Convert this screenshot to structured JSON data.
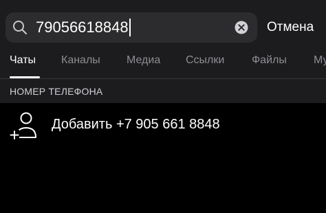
{
  "search": {
    "value": "79056618848",
    "cancel_label": "Отмена"
  },
  "tabs": [
    {
      "label": "Чаты",
      "active": true
    },
    {
      "label": "Каналы",
      "active": false
    },
    {
      "label": "Медиа",
      "active": false
    },
    {
      "label": "Ссылки",
      "active": false
    },
    {
      "label": "Файлы",
      "active": false
    },
    {
      "label": "Му",
      "active": false
    }
  ],
  "section": {
    "title": "НОМЕР ТЕЛЕФОНА"
  },
  "add_contact": {
    "label": "Добавить +7 905 661 8848",
    "icon": "add-user-icon"
  },
  "colors": {
    "background": "#000000",
    "header_background": "#1c1c1e",
    "search_field": "#2c2c2e",
    "inactive_tab": "#8e8e93"
  }
}
